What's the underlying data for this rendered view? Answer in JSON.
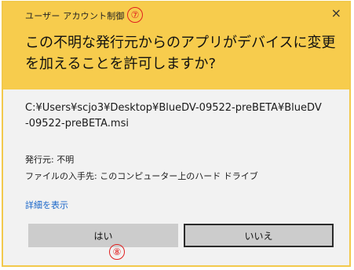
{
  "dialog": {
    "title": "ユーザー アカウント制御",
    "close_glyph": "×",
    "question": "この不明な発行元からのアプリがデバイスに変更を加えることを許可しますか?",
    "file_path": "C:¥Users¥scjo3¥Desktop¥BlueDV-09522-preBETA¥BlueDV-09522-preBETA.msi",
    "publisher": "発行元: 不明",
    "origin": "ファイルの入手先: このコンピューター上のハード ドライブ",
    "details_link": "詳細を表示",
    "yes_button": "はい",
    "no_button": "いいえ",
    "header_color": "#f7cc4d",
    "link_color": "#1a66c9"
  },
  "annotations": {
    "marker_7": "⑦",
    "marker_8": "⑧",
    "color": "#e02020"
  }
}
